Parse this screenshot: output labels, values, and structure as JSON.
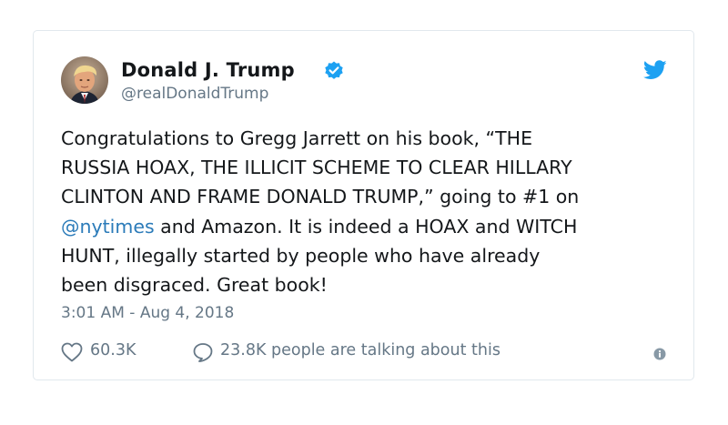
{
  "author": {
    "name": "Donald J. Trump",
    "handle": "@realDonaldTrump",
    "avatar_icon": "profile-photo",
    "verified_icon": "verified-badge-icon"
  },
  "tweet": {
    "lines": [
      "Congratulations to Gregg Jarrett on his book, “THE",
      "RUSSIA HOAX, THE ILLICIT SCHEME TO CLEAR HILLARY",
      "CLINTON AND FRAME DONALD TRUMP,” going to #1 on"
    ],
    "mention": "@nytimes",
    "line4_rest": " and Amazon. It is indeed a HOAX and WITCH",
    "lines_end": [
      "HUNT, illegally started by people who have already",
      "been disgraced. Great book!"
    ]
  },
  "timestamp": "3:01 AM - Aug 4, 2018",
  "stats": {
    "likes": "60.3K",
    "replies_text": "23.8K people are talking about this"
  },
  "colors": {
    "text": "#14171a",
    "muted": "#657786",
    "link": "#2b7bb9",
    "twitter_blue": "#1da1f2",
    "border": "#e1e8ed"
  }
}
